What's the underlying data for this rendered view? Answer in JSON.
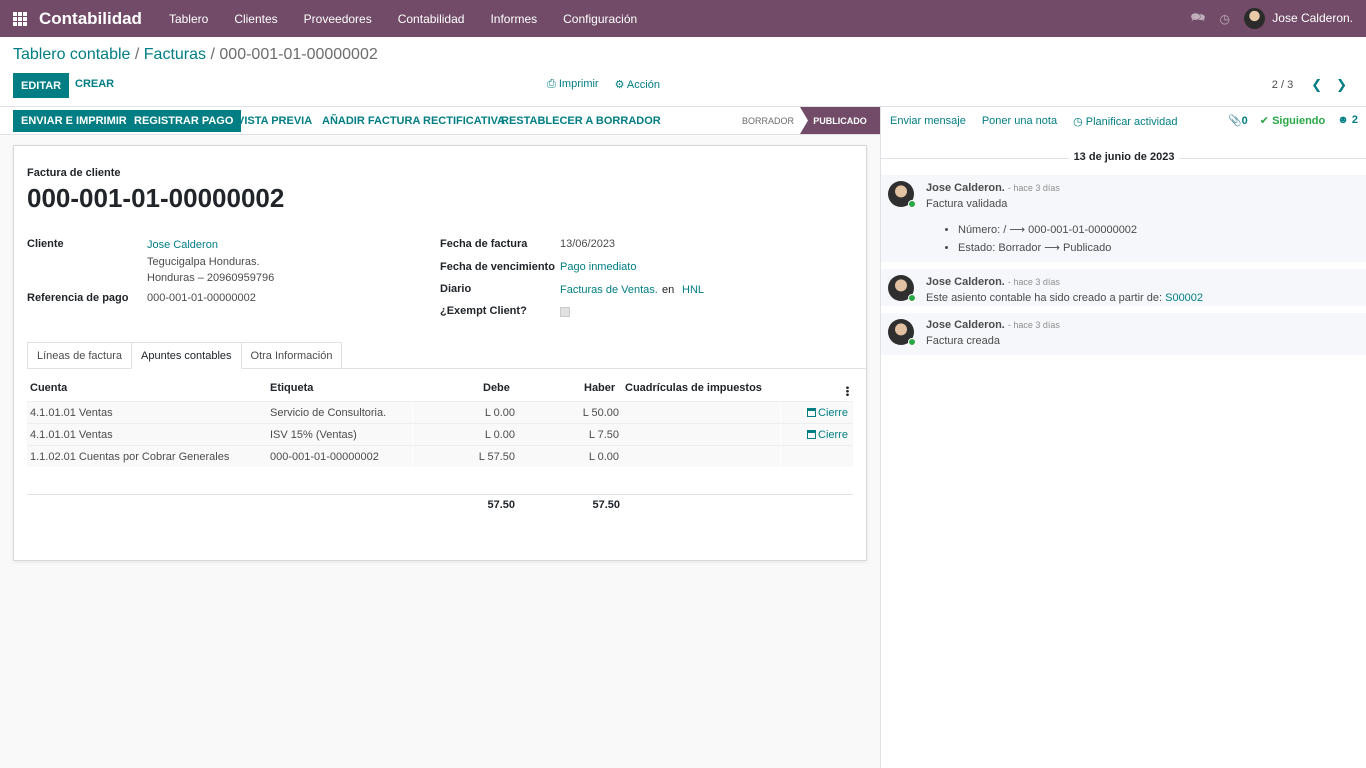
{
  "navbar": {
    "app_name": "Contabilidad",
    "menu": [
      "Tablero",
      "Clientes",
      "Proveedores",
      "Contabilidad",
      "Informes",
      "Configuración"
    ],
    "user_name": "Jose Calderon."
  },
  "breadcrumb": {
    "item1": "Tablero contable",
    "sep1": "/",
    "item2": "Facturas",
    "sep2": "/",
    "current": "000-001-01-00000002"
  },
  "toolbar": {
    "edit_label": "EDITAR",
    "create_label": "CREAR",
    "print_label": "Imprimir",
    "action_label": "Acción",
    "pager_value": "2 / 3"
  },
  "statusbar": {
    "buttons": [
      "ENVIAR E IMPRIMIR",
      "REGISTRAR PAGO",
      "VISTA PREVIA",
      "AÑADIR FACTURA RECTIFICATIVA",
      "RESTABLECER A BORRADOR"
    ],
    "stage_draft": "BORRADOR",
    "stage_posted": "PUBLICADO"
  },
  "form": {
    "doc_type": "Factura de cliente",
    "name": "000-001-01-00000002",
    "customer_label": "Cliente",
    "customer": "Jose Calderon",
    "address_line1": "Tegucigalpa Honduras.",
    "address_line2": "Honduras – 20960959796",
    "payment_ref_label": "Referencia de pago",
    "payment_ref": "000-001-01-00000002",
    "invoice_date_label": "Fecha de factura",
    "invoice_date": "13/06/2023",
    "due_date_label": "Fecha de vencimiento",
    "due_date": "Pago inmediato",
    "journal_label": "Diario",
    "journal": "Facturas de Ventas.",
    "journal_in": "en",
    "currency": "HNL",
    "exempt_label": "¿Exempt Client?"
  },
  "tabs": [
    "Líneas de factura",
    "Apuntes contables",
    "Otra Información"
  ],
  "grid": {
    "headers": {
      "account": "Cuenta",
      "label": "Etiqueta",
      "debit": "Debe",
      "credit": "Haber",
      "tax_grids": "Cuadrículas de impuestos"
    },
    "rows": [
      {
        "account": "4.1.01.01 Ventas",
        "label": "Servicio de Consultoria.",
        "debit": "L 0.00",
        "credit": "L 50.00",
        "action": "Cierre"
      },
      {
        "account": "4.1.01.01 Ventas",
        "label": "ISV 15% (Ventas)",
        "debit": "L 0.00",
        "credit": "L 7.50",
        "action": "Cierre"
      },
      {
        "account": "1.1.02.01 Cuentas por Cobrar Generales",
        "label": "000-001-01-00000002",
        "debit": "L 57.50",
        "credit": "L 0.00",
        "action": ""
      }
    ],
    "total_debit": "57.50",
    "total_credit": "57.50"
  },
  "chatter": {
    "send_message": "Enviar mensaje",
    "log_note": "Poner una nota",
    "schedule": "Planificar actividad",
    "attachments": "0",
    "following": "Siguiendo",
    "followers": "2",
    "date": "13 de junio de 2023",
    "messages": [
      {
        "author": "Jose Calderon.",
        "time": "- hace 3 días",
        "body": "Factura validada",
        "changes": [
          "Número: / ⟶ 000-001-01-00000002",
          "Estado: Borrador ⟶ Publicado"
        ]
      },
      {
        "author": "Jose Calderon.",
        "time": "- hace 3 días",
        "body": "Este asiento contable ha sido creado a partir de:",
        "link": "S00002"
      },
      {
        "author": "Jose Calderon.",
        "time": "- hace 3 días",
        "body": "Factura creada"
      }
    ]
  }
}
